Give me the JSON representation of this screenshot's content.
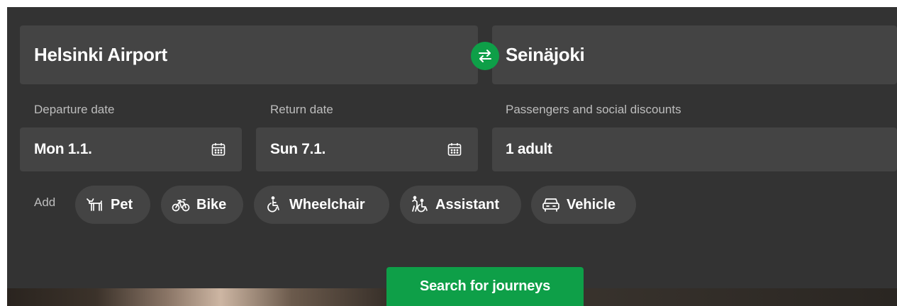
{
  "origin": {
    "value": "Helsinki Airport"
  },
  "destination": {
    "value": "Seinäjoki"
  },
  "swap": {
    "icon": "swap-arrows-icon"
  },
  "departure": {
    "label": "Departure date",
    "value": "Mon 1.1.",
    "icon": "calendar-icon"
  },
  "return_date": {
    "label": "Return date",
    "value": "Sun 7.1.",
    "icon": "calendar-icon"
  },
  "passengers": {
    "label": "Passengers and social discounts",
    "value": "1 adult"
  },
  "extras": {
    "label": "Add",
    "items": [
      {
        "label": "Pet",
        "icon": "pet-icon"
      },
      {
        "label": "Bike",
        "icon": "bike-icon"
      },
      {
        "label": "Wheelchair",
        "icon": "wheelchair-icon"
      },
      {
        "label": "Assistant",
        "icon": "assistant-icon"
      },
      {
        "label": "Vehicle",
        "icon": "vehicle-icon"
      }
    ]
  },
  "search": {
    "label": "Search for journeys"
  },
  "colors": {
    "panel": "#333333",
    "field": "#444444",
    "accent": "#0e9f48",
    "label": "#bdbdbd",
    "text": "#ffffff"
  }
}
